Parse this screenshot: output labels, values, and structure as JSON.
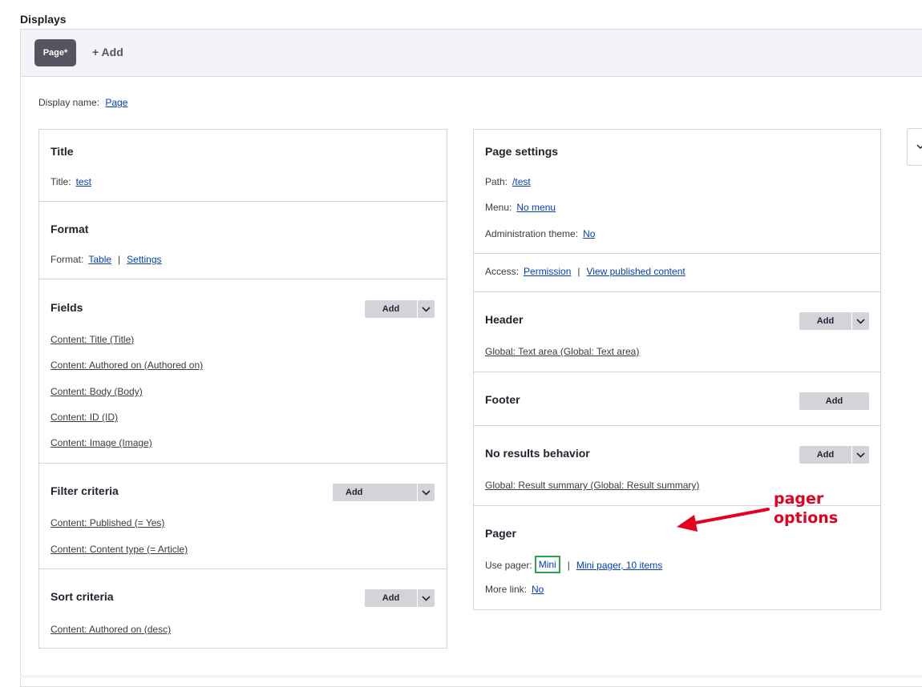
{
  "displays_title": "Displays",
  "tabs": {
    "page": "Page*",
    "add": "+ Add"
  },
  "display_name": {
    "label": "Display name:",
    "value": "Page"
  },
  "left": {
    "title": {
      "heading": "Title",
      "label": "Title:",
      "value": "test"
    },
    "format": {
      "heading": "Format",
      "label": "Format:",
      "value": "Table",
      "settings": "Settings"
    },
    "fields": {
      "heading": "Fields",
      "add": "Add",
      "items": [
        "Content: Title (Title)",
        "Content: Authored on (Authored on)",
        "Content: Body (Body)",
        "Content: ID (ID)",
        "Content: Image (Image)"
      ]
    },
    "filter": {
      "heading": "Filter criteria",
      "add": "Add",
      "items": [
        "Content: Published (= Yes)",
        "Content: Content type (= Article)"
      ]
    },
    "sort": {
      "heading": "Sort criteria",
      "add": "Add",
      "items": [
        "Content: Authored on (desc)"
      ]
    }
  },
  "right": {
    "page_settings": {
      "heading": "Page settings",
      "path_label": "Path:",
      "path": "/test",
      "menu_label": "Menu:",
      "menu": "No menu",
      "admin_label": "Administration theme:",
      "admin": "No"
    },
    "access": {
      "label": "Access:",
      "permission": "Permission",
      "value": "View published content"
    },
    "header": {
      "heading": "Header",
      "add": "Add",
      "item": "Global: Text area (Global: Text area)"
    },
    "footer": {
      "heading": "Footer",
      "add": "Add"
    },
    "no_results": {
      "heading": "No results behavior",
      "add": "Add",
      "item": "Global: Result summary (Global: Result summary)"
    },
    "pager": {
      "heading": "Pager",
      "use_label": "Use pager:",
      "use": "Mini",
      "options": "Mini pager, 10 items",
      "more_label": "More link:",
      "more": "No"
    }
  },
  "annotation": {
    "line1": "pager",
    "line2": "options",
    "color": "#e5001f"
  }
}
